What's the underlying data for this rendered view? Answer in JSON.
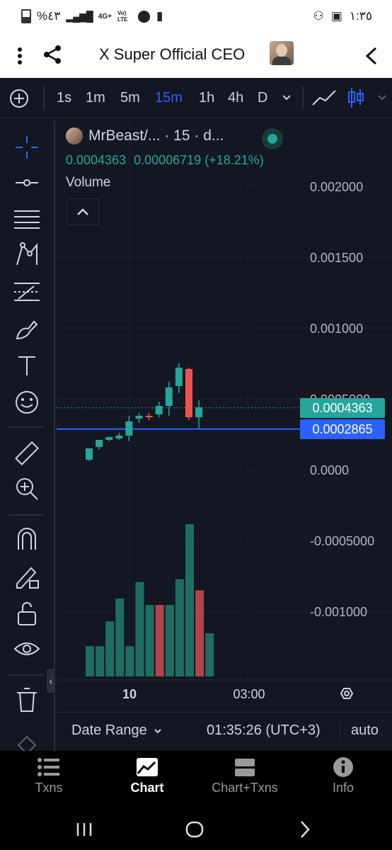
{
  "status_bar": {
    "battery": "%٤٣",
    "signal": "4G+",
    "volte": "Vo) LTE",
    "time": "١:٣٥"
  },
  "header": {
    "title": "X Super Official CEO"
  },
  "timeframes": {
    "items": [
      "1s",
      "1m",
      "5m",
      "15m",
      "1h",
      "4h",
      "D"
    ],
    "active": "15m"
  },
  "legend": {
    "symbol": "MrBeast/... · 15 · d...",
    "price": "0.0004363",
    "change": "0.00006719 (+18.21%)",
    "volume_label": "Volume"
  },
  "price_axis": {
    "ticks": [
      "0.002000",
      "0.001500",
      "0.001000",
      "0.0000",
      "-0.0005000",
      "-0.001000"
    ],
    "hidden_tick": "0.0005000"
  },
  "price_tags": {
    "last": "0.0004363",
    "line": "0.0002865"
  },
  "time_axis": {
    "ticks": [
      "10",
      "03:00"
    ]
  },
  "bottom_info": {
    "date_range": "Date Range",
    "clock": "01:35:26 (UTC+3)",
    "mode": "auto"
  },
  "tabs": [
    {
      "label": "Txns"
    },
    {
      "label": "Chart"
    },
    {
      "label": "Chart+Txns"
    },
    {
      "label": "Info"
    }
  ],
  "colors": {
    "up": "#26a69a",
    "down": "#ef5350",
    "accent": "#2962ff",
    "vol_up": "#1e6e60",
    "vol_down": "#b2434c"
  },
  "chart_data": {
    "type": "candlestick",
    "candles": [
      {
        "o": 7e-05,
        "h": 9e-05,
        "l": 6e-05,
        "c": 0.00015,
        "color": "up"
      },
      {
        "o": 0.00016,
        "h": 0.0002,
        "l": 0.00014,
        "c": 0.00021,
        "color": "up"
      },
      {
        "o": 0.00021,
        "h": 0.00023,
        "l": 0.0002,
        "c": 0.00023,
        "color": "up"
      },
      {
        "o": 0.00022,
        "h": 0.00026,
        "l": 0.00021,
        "c": 0.00024,
        "color": "up"
      },
      {
        "o": 0.00024,
        "h": 0.00038,
        "l": 0.0002,
        "c": 0.00034,
        "color": "up"
      },
      {
        "o": 0.00036,
        "h": 0.0004,
        "l": 0.00033,
        "c": 0.00038,
        "color": "up"
      },
      {
        "o": 0.00038,
        "h": 0.0004,
        "l": 0.00035,
        "c": 0.00038,
        "color": "down"
      },
      {
        "o": 0.00039,
        "h": 0.00048,
        "l": 0.00037,
        "c": 0.00045,
        "color": "up"
      },
      {
        "o": 0.00045,
        "h": 0.00062,
        "l": 0.00038,
        "c": 0.00058,
        "color": "up"
      },
      {
        "o": 0.00059,
        "h": 0.00075,
        "l": 0.00054,
        "c": 0.00072,
        "color": "up"
      },
      {
        "o": 0.00071,
        "h": 0.00072,
        "l": 0.00035,
        "c": 0.00037,
        "color": "down"
      },
      {
        "o": 0.00037,
        "h": 0.00049,
        "l": 0.00029,
        "c": 0.00044,
        "color": "up"
      }
    ],
    "volume": [
      {
        "v": 0.33,
        "color": "up"
      },
      {
        "v": 0.33,
        "color": "up"
      },
      {
        "v": 0.6,
        "color": "up"
      },
      {
        "v": 0.85,
        "color": "up"
      },
      {
        "v": 0.33,
        "color": "up"
      },
      {
        "v": 1.03,
        "color": "up"
      },
      {
        "v": 0.78,
        "color": "up"
      },
      {
        "v": 0.78,
        "color": "down"
      },
      {
        "v": 0.78,
        "color": "up"
      },
      {
        "v": 1.06,
        "color": "up"
      },
      {
        "v": 1.66,
        "color": "up"
      },
      {
        "v": 0.94,
        "color": "down"
      },
      {
        "v": 0.47,
        "color": "up"
      }
    ],
    "ylim": [
      -0.0012,
      0.0021
    ],
    "line_price": 0.0002865,
    "last_price": 0.0004363
  }
}
